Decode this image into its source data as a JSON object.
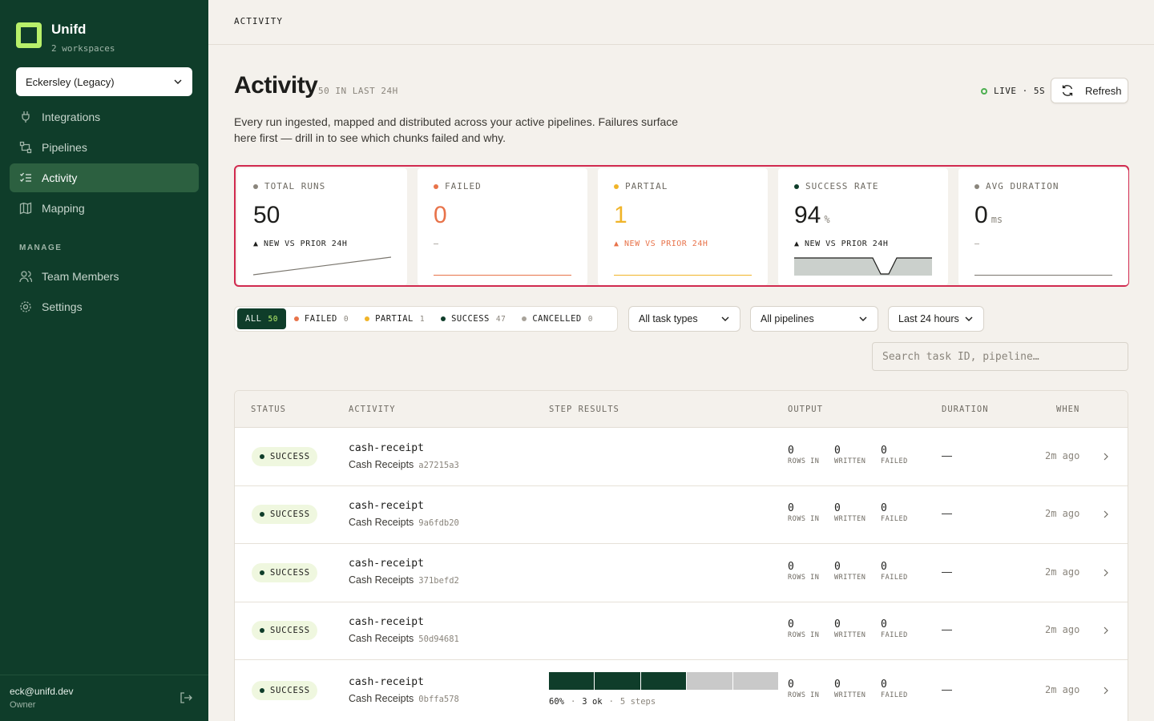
{
  "app": {
    "name": "Unifd",
    "workspaces_label": "2 workspaces",
    "workspace_selected": "Eckersley (Legacy)"
  },
  "nav": {
    "items": [
      {
        "label": "Integrations",
        "icon": "plug-icon"
      },
      {
        "label": "Pipelines",
        "icon": "pipeline-icon"
      },
      {
        "label": "Activity",
        "icon": "list-check-icon",
        "active": true
      },
      {
        "label": "Mapping",
        "icon": "map-icon"
      }
    ],
    "manage_label": "MANAGE",
    "manage_items": [
      {
        "label": "Team Members",
        "icon": "users-icon"
      },
      {
        "label": "Settings",
        "icon": "gear-icon"
      }
    ]
  },
  "user": {
    "email": "eck@unifd.dev",
    "role": "Owner"
  },
  "topbar": {
    "breadcrumb": "ACTIVITY"
  },
  "header": {
    "title": "Activity",
    "meta": "50 IN LAST 24H",
    "live_label": "LIVE · 5S",
    "refresh_label": "Refresh",
    "description": "Every run ingested, mapped and distributed across your active pipelines. Failures surface here first — drill in to see which chunks failed and why."
  },
  "kpis": [
    {
      "label": "TOTAL RUNS",
      "value": "50",
      "unit": "",
      "delta": "▲ NEW VS PRIOR 24H",
      "dot": "#8a857c",
      "value_color": "#1d1d1b",
      "delta_color": "#1d1d1b"
    },
    {
      "label": "FAILED",
      "value": "0",
      "unit": "",
      "delta": "—",
      "dot": "#e8734a",
      "value_color": "#e8734a",
      "delta_color": "#8a857c"
    },
    {
      "label": "PARTIAL",
      "value": "1",
      "unit": "",
      "delta": "▲ NEW VS PRIOR 24H",
      "dot": "#f0b429",
      "value_color": "#f0b429",
      "delta_color": "#e8734a"
    },
    {
      "label": "SUCCESS RATE",
      "value": "94",
      "unit": "%",
      "delta": "▲ NEW VS PRIOR 24H",
      "dot": "#0f3d2a",
      "value_color": "#1d1d1b",
      "delta_color": "#1d1d1b"
    },
    {
      "label": "AVG DURATION",
      "value": "0",
      "unit": "ms",
      "delta": "—",
      "dot": "#8a857c",
      "value_color": "#1d1d1b",
      "delta_color": "#8a857c"
    }
  ],
  "filters": {
    "chips": [
      {
        "label": "ALL",
        "count": "50",
        "active": true,
        "dot": ""
      },
      {
        "label": "FAILED",
        "count": "0",
        "dot": "#e8734a"
      },
      {
        "label": "PARTIAL",
        "count": "1",
        "dot": "#f0b429"
      },
      {
        "label": "SUCCESS",
        "count": "47",
        "dot": "#0f3d2a"
      },
      {
        "label": "CANCELLED",
        "count": "0",
        "dot": "#a8a39a"
      }
    ],
    "task_type": "All task types",
    "pipeline": "All pipelines",
    "range": "Last 24 hours",
    "search_placeholder": "Search task ID, pipeline…"
  },
  "table": {
    "headers": {
      "status": "STATUS",
      "activity": "ACTIVITY",
      "steps": "STEP RESULTS",
      "output": "OUTPUT",
      "duration": "DURATION",
      "when": "WHEN"
    },
    "output_labels": {
      "rows_in": "ROWS IN",
      "written": "WRITTEN",
      "failed": "FAILED"
    },
    "rows": [
      {
        "status": "SUCCESS",
        "name": "cash-receipt",
        "pipeline": "Cash Receipts",
        "hash": "a27215a3",
        "rows_in": "0",
        "written": "0",
        "failed": "0",
        "duration": "—",
        "when": "2m ago"
      },
      {
        "status": "SUCCESS",
        "name": "cash-receipt",
        "pipeline": "Cash Receipts",
        "hash": "9a6fdb20",
        "rows_in": "0",
        "written": "0",
        "failed": "0",
        "duration": "—",
        "when": "2m ago"
      },
      {
        "status": "SUCCESS",
        "name": "cash-receipt",
        "pipeline": "Cash Receipts",
        "hash": "371befd2",
        "rows_in": "0",
        "written": "0",
        "failed": "0",
        "duration": "—",
        "when": "2m ago"
      },
      {
        "status": "SUCCESS",
        "name": "cash-receipt",
        "pipeline": "Cash Receipts",
        "hash": "50d94681",
        "rows_in": "0",
        "written": "0",
        "failed": "0",
        "duration": "—",
        "when": "2m ago"
      },
      {
        "status": "SUCCESS",
        "name": "cash-receipt",
        "pipeline": "Cash Receipts",
        "hash": "0bffa578",
        "rows_in": "0",
        "written": "0",
        "failed": "0",
        "duration": "—",
        "when": "2m ago",
        "steps": {
          "ok": 3,
          "total": 5,
          "percent_label": "60%",
          "ok_label": "3 ok",
          "total_label": "5 steps"
        }
      }
    ]
  },
  "colors": {
    "brand_dark": "#0f3d2a",
    "accent_lime": "#b8f06a",
    "alert_border": "#d12a4f"
  }
}
